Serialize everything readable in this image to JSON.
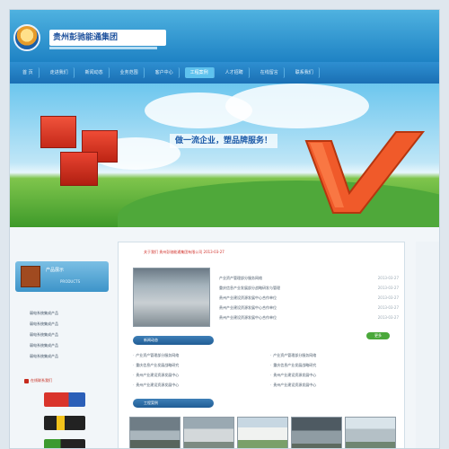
{
  "header": {
    "logo_text": "贵州彭驰能通集团",
    "logo_icon": "sunrise-globe-icon"
  },
  "nav": {
    "items": [
      {
        "label": "首 页",
        "active": false
      },
      {
        "label": "走进我们",
        "active": false
      },
      {
        "label": "新闻动态",
        "active": false
      },
      {
        "label": "业务范围",
        "active": false
      },
      {
        "label": "客户中心",
        "active": false
      },
      {
        "label": "工程案例",
        "active": true
      },
      {
        "label": "人才招聘",
        "active": false
      },
      {
        "label": "在线留言",
        "active": false
      },
      {
        "label": "联系我们",
        "active": false
      }
    ]
  },
  "banner": {
    "slogan": "做一流企业，塑品牌服务！"
  },
  "sidebar": {
    "product_title": "产品展示",
    "product_sub": "PRODUCTS",
    "links": [
      "弱电系统集成产品",
      "弱电系统集成产品",
      "弱电系统集成产品",
      "弱电系统集成产品",
      "弱电系统集成产品"
    ],
    "contact_title": "在线联系我们",
    "badges": [
      {
        "name": "baidu-logo",
        "color": "#d9342b"
      },
      {
        "name": "qq-logo",
        "color": "#222222"
      },
      {
        "name": "msn-logo",
        "color": "#3c9a2f"
      }
    ]
  },
  "main": {
    "title": "关于我们 贵州彭驰能通集团有限公司  2013-03-27",
    "news": [
      {
        "text": "产业资产管理部分服务网络",
        "date": "2013-03-27"
      },
      {
        "text": "重庆信息产业发展部分战略研发与管理",
        "date": "2013-03-27"
      },
      {
        "text": "贵州产业建设资源发展中心合作单位",
        "date": "2013-03-27"
      },
      {
        "text": "贵州产业建设资源发展中心合作单位",
        "date": "2013-03-27"
      },
      {
        "text": "贵州产业建设资源发展中心合作单位",
        "date": "2013-03-27"
      }
    ],
    "more_label": "更多",
    "section1_label": "新闻动态",
    "col_left": [
      "产业资产管理部分服务网络",
      "重庆信息产业发展战略研究",
      "贵州产业建设资源发展中心",
      "贵州产业建设资源发展中心"
    ],
    "col_right": [
      "产业资产管理部分服务网络",
      "重庆信息产业发展战略研究",
      "贵州产业建设资源发展中心",
      "贵州产业建设资源发展中心"
    ],
    "section2_label": "工程案例"
  }
}
